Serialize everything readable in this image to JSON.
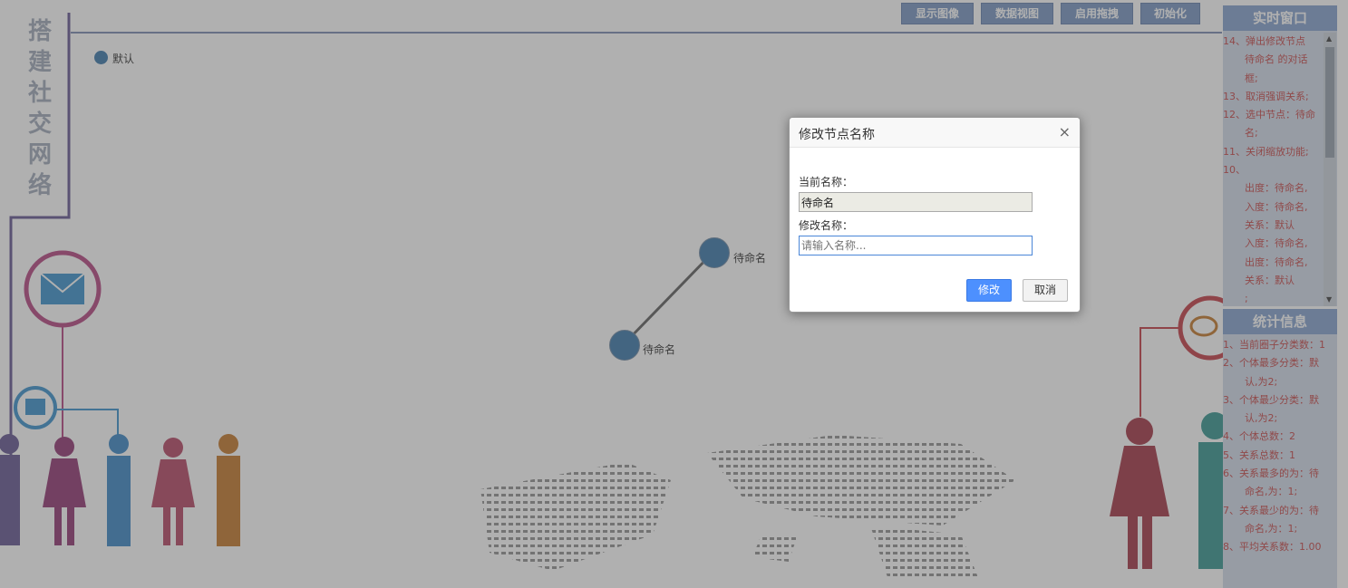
{
  "toolbar": {
    "show_image": "显示图像",
    "data_view": "数据视图",
    "enable_drag": "启用拖拽",
    "initialize": "初始化"
  },
  "app_title": [
    "搭",
    "建",
    "社",
    "交",
    "网",
    "络"
  ],
  "legend": {
    "label": "默认",
    "color": "#2f6fa6"
  },
  "graph": {
    "nodes": [
      {
        "label": "待命名"
      },
      {
        "label": "待命名"
      }
    ]
  },
  "realtime_panel": {
    "title": "实时窗口",
    "lines": [
      "14、弹出修改节点",
      "待命名 的对话",
      "框;",
      "13、取消强调关系;",
      "12、选中节点：待命",
      "名;",
      "11、关闭缩放功能;",
      "10、",
      "出度：待命名,",
      "入度：待命名,",
      "关系：默认",
      "入度：待命名,",
      "出度：待命名,",
      "关系：默认",
      ";"
    ]
  },
  "stats_panel": {
    "title": "统计信息",
    "lines": [
      "1、当前圈子分类数：1",
      "2、个体最多分类：默",
      "认,为2;",
      "3、个体最少分类：默",
      "认,为2;",
      "4、个体总数：2",
      "5、关系总数：1",
      "6、关系最多的为：待",
      "命名,为：1;",
      "7、关系最少的为：待",
      "命名,为：1;",
      "8、平均关系数：1.00"
    ]
  },
  "modal": {
    "title": "修改节点名称",
    "close": "×",
    "current_label": "当前名称：",
    "current_value": "待命名",
    "new_label": "修改名称：",
    "new_placeholder": "请输入名称...",
    "ok": "修改",
    "cancel": "取消"
  },
  "colors": {
    "accent": "#4d90fe",
    "node": "#2f6fa6",
    "log_text": "#c23b3b",
    "panel_header": "#7d9ccb"
  }
}
